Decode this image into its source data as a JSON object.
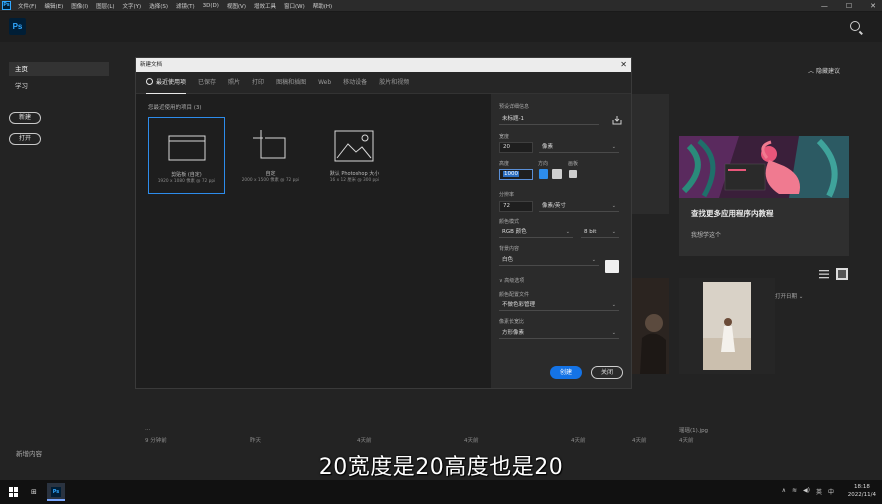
{
  "menubar": {
    "items": [
      "文件(F)",
      "编辑(E)",
      "图像(I)",
      "图层(L)",
      "文字(Y)",
      "选择(S)",
      "滤镜(T)",
      "3D(D)",
      "视图(V)",
      "增效工具",
      "窗口(W)",
      "帮助(H)"
    ],
    "min": "—",
    "max": "☐",
    "close": "✕"
  },
  "app": {
    "logo": "Ps"
  },
  "home": {
    "nav": [
      "主页",
      "学习"
    ],
    "new_btn": "新建",
    "open_btn": "打开",
    "bottom_link": "新增内容"
  },
  "background": {
    "welcome_link": "隐藏建议",
    "promo_title": "查找更多应用程序内教程",
    "promo_sub": "我想学这个",
    "sort_label": "排序",
    "sort_value": "最近打开日期",
    "recents": [
      {
        "name": "...",
        "meta": "9 分钟前"
      },
      {
        "name": "",
        "meta": "昨天"
      },
      {
        "name": "",
        "meta": "4天前"
      },
      {
        "name": "",
        "meta": "4天前"
      },
      {
        "name": "",
        "meta": "4天前"
      },
      {
        "name": "",
        "meta": "4天前"
      },
      {
        "name": "瑶瑶(1).jpg",
        "meta": "4天前"
      }
    ]
  },
  "dialog": {
    "title": "新建文档",
    "tabs": [
      "最近使用项",
      "已保存",
      "照片",
      "打印",
      "图稿和插图",
      "Web",
      "移动设备",
      "胶片和视频"
    ],
    "section_label": "您最近使用的项目 (3)",
    "presets": [
      {
        "name": "剪贴板 (自定)",
        "dim": "1920 x 1080 像素 @ 72 ppi"
      },
      {
        "name": "自定",
        "dim": "2000 x 1500 像素 @ 72 ppi"
      },
      {
        "name": "默认 Photoshop 大小",
        "dim": "16 x 12 厘米 @ 300 ppi"
      }
    ],
    "details": {
      "section": "预设详细信息",
      "doc_name": "未标题-1",
      "width_label": "宽度",
      "width_value": "20",
      "width_unit": "像素",
      "height_label": "高度",
      "height_value": "1000",
      "orientation_label": "方向",
      "artboard_label": "画板",
      "resolution_label": "分辨率",
      "resolution_value": "72",
      "resolution_unit": "像素/英寸",
      "color_mode_label": "颜色模式",
      "color_mode_value": "RGB 颜色",
      "bit_depth": "8 bit",
      "bg_label": "背景内容",
      "bg_value": "白色",
      "advanced_label": "高级选项",
      "profile_label": "颜色配置文件",
      "profile_value": "不做色彩管理",
      "pixel_ratio_label": "像素长宽比",
      "pixel_ratio_value": "方形像素",
      "create_btn": "创建",
      "close_btn": "关闭"
    }
  },
  "subtitle": "20宽度是20高度也是20",
  "taskbar": {
    "tray_items": [
      "∧",
      "英",
      "中"
    ],
    "time": "18:18",
    "date": "2022/11/4"
  }
}
